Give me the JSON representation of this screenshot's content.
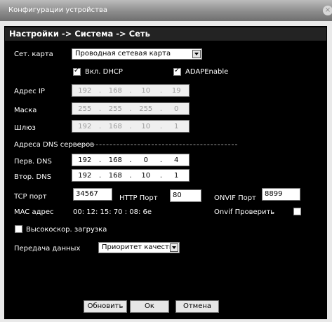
{
  "window": {
    "title": "Конфигурации устройства",
    "close_icon": "×"
  },
  "header": {
    "path": "Настройки -> Система -> Сеть"
  },
  "form": {
    "net_card_label": "Сет. карта",
    "net_card_value": "Проводная сетевая карта",
    "dhcp_label": "Вкл. DHCP",
    "dhcp_checked": true,
    "adap_label": "ADAPEnable",
    "adap_checked": true,
    "ip_label": "Адрес IP",
    "ip": [
      "192",
      "168",
      "10",
      "19"
    ],
    "mask_label": "Маска",
    "mask": [
      "255",
      "255",
      "255",
      "0"
    ],
    "gateway_label": "Шлюз",
    "gateway": [
      "192",
      "168",
      "10",
      "1"
    ],
    "dns_section_label": "Адреса DNS серверов",
    "dns1_label": "Перв. DNS",
    "dns1": [
      "192",
      "168",
      "0",
      "4"
    ],
    "dns2_label": "Втор. DNS",
    "dns2": [
      "192",
      "168",
      "10",
      "1"
    ],
    "tcp_label": "TCP порт",
    "tcp_value": "34567",
    "http_label": "HTTP Порт",
    "http_value": "80",
    "onvif_label": "ONVIF Порт",
    "onvif_value": "8899",
    "mac_label": "MAC адрес",
    "mac_value": "00: 12: 15: 70 : 08: 6e",
    "onvif_check_label": "Onvif Проверить",
    "onvif_check_checked": false,
    "highspeed_label": "Высокоскор. загрузка",
    "highspeed_checked": false,
    "transfer_label": "Передача данных",
    "transfer_value": "Приоритет качеству"
  },
  "buttons": {
    "refresh": "Обновить",
    "ok": "Ок",
    "cancel": "Отмена"
  },
  "colors": {
    "background": "#000000",
    "titlebar": "#8c8c8c",
    "header": "#232323"
  }
}
